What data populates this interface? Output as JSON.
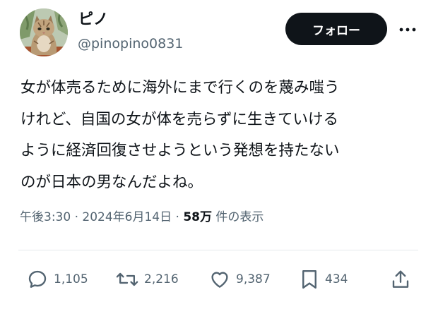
{
  "user": {
    "display_name": "ピノ",
    "handle": "@pinopino0831",
    "avatar": "cat-avatar"
  },
  "follow_button": {
    "label": "フォロー"
  },
  "more_button": {
    "icon": "more-dots-icon"
  },
  "tweet": {
    "lines": [
      "女が体売るために海外にまで行くのを蔑み嗤う",
      "けれど、自国の女が体を売らずに生きていける",
      "ように経済回復させようという発想を持たない",
      "のが日本の男なんだよね。"
    ]
  },
  "meta": {
    "time": "午後3:30",
    "separator": "·",
    "date": "2024年6月14日",
    "views": "58万",
    "views_label": "件の表示"
  },
  "actions": {
    "reply": {
      "icon": "reply-icon",
      "count": "1,105"
    },
    "retweet": {
      "icon": "retweet-icon",
      "count": "2,216"
    },
    "like": {
      "icon": "heart-icon",
      "count": "9,387"
    },
    "bookmark": {
      "icon": "bookmark-icon",
      "count": "434"
    },
    "share": {
      "icon": "share-icon"
    }
  },
  "colors": {
    "text": "#0f1419",
    "secondary": "#536471",
    "button_bg": "#0f1419",
    "button_text": "#ffffff",
    "divider": "#e6e9eb"
  }
}
